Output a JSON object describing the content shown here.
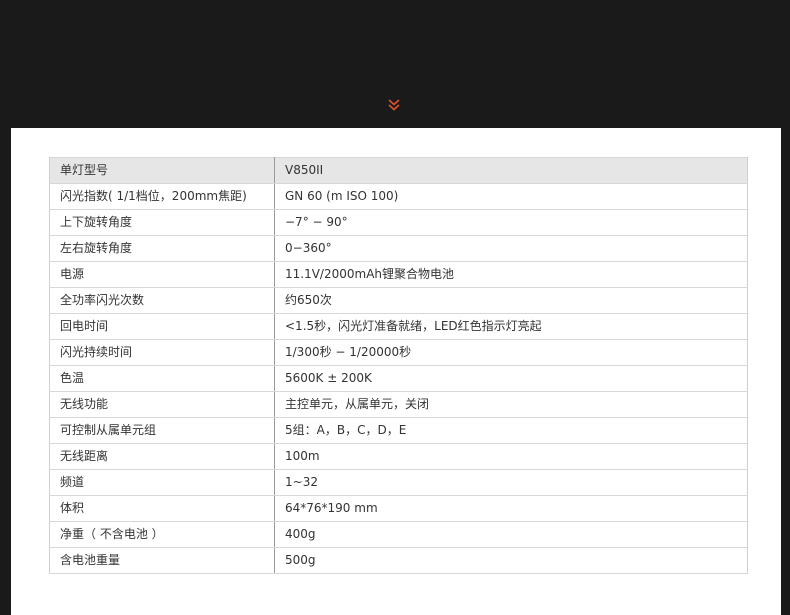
{
  "page": {
    "background_color": "#1a1a1a",
    "card_color": "#ffffff",
    "accent_color": "#e0532e",
    "scroll_icon": "double-chevron-down-icon"
  },
  "spec_table": {
    "rows": [
      {
        "label": "单灯型号",
        "value": "V850II"
      },
      {
        "label": "闪光指数( 1/1档位，200mm焦距)",
        "value": "GN 60 (m ISO 100)"
      },
      {
        "label": "上下旋转角度",
        "value": "−7° − 90°"
      },
      {
        "label": "左右旋转角度",
        "value": "0−360°"
      },
      {
        "label": "电源",
        "value": "11.1V/2000mAh锂聚合物电池"
      },
      {
        "label": "全功率闪光次数",
        "value": "约650次"
      },
      {
        "label": "回电时间",
        "value": "<1.5秒，闪光灯准备就绪，LED红色指示灯亮起"
      },
      {
        "label": "闪光持续时间",
        "value": "1/300秒 − 1/20000秒"
      },
      {
        "label": "色温",
        "value": "5600K ± 200K"
      },
      {
        "label": "无线功能",
        "value": "主控单元，从属单元，关闭"
      },
      {
        "label": "可控制从属单元组",
        "value": "5组：A，B，C，D，E"
      },
      {
        "label": "无线距离",
        "value": "100m"
      },
      {
        "label": "频道",
        "value": "1~32"
      },
      {
        "label": "体积",
        "value": "64*76*190 mm"
      },
      {
        "label": "净重（ 不含电池 ）",
        "value": "400g"
      },
      {
        "label": "含电池重量",
        "value": "500g"
      }
    ]
  }
}
